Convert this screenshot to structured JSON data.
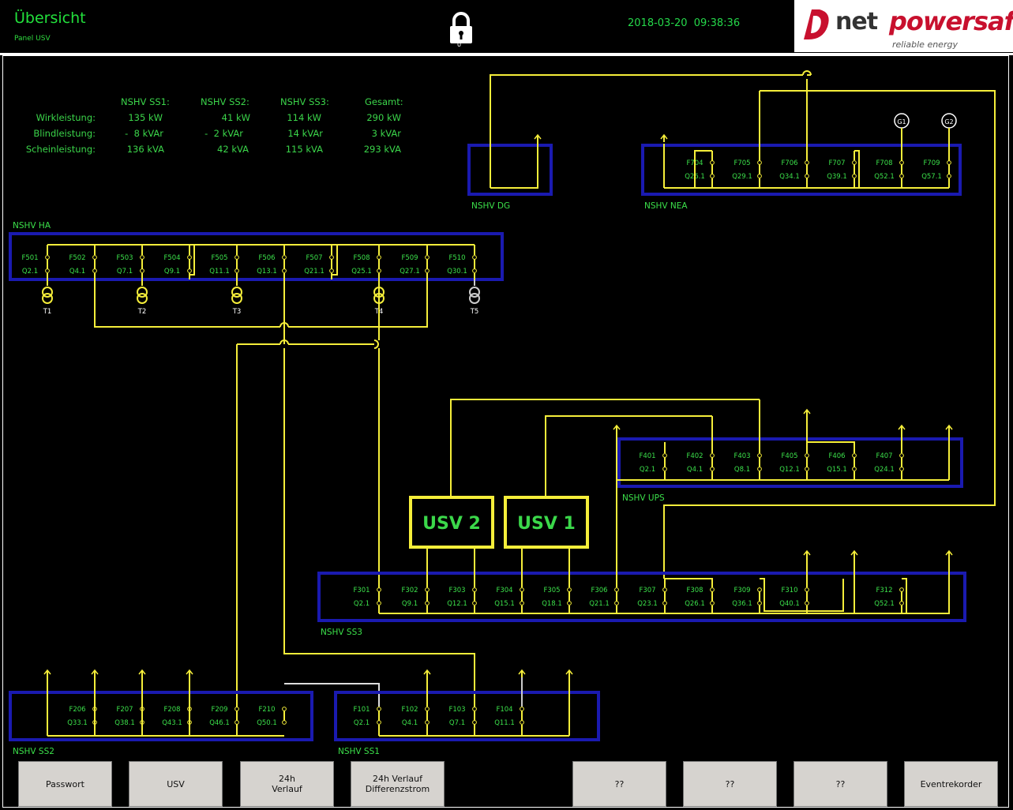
{
  "header": {
    "title": "Übersicht",
    "subtitle": "Panel USV",
    "lock_count": "0",
    "date": "2018-03-20",
    "time": "09:38:36"
  },
  "logo": {
    "word1": "net",
    "word2": "powersafe",
    "tagline": "reliable energy"
  },
  "stats": {
    "columns": [
      "NSHV SS1:",
      "NSHV SS2:",
      "NSHV SS3:",
      "Gesamt:"
    ],
    "rows": [
      {
        "label": "Wirkleistung:",
        "values": [
          "135 kW",
          "41 kW",
          "114 kW",
          "290 kW"
        ]
      },
      {
        "label": "Blindleistung:",
        "values": [
          "-  8 kVAr",
          "-  2 kVAr",
          "14 kVAr",
          "3 kVAr"
        ]
      },
      {
        "label": "Scheinleistung:",
        "values": [
          "136 kVA",
          "42 kVA",
          "115 kVA",
          "293 kVA"
        ]
      }
    ]
  },
  "panels": {
    "ha": "NSHV HA",
    "dg": "NSHV DG",
    "nea": "NSHV NEA",
    "ups": "NSHV UPS",
    "ss3": "NSHV SS3",
    "ss2": "NSHV SS2",
    "ss1": "NSHV SS1"
  },
  "usv": {
    "usv2": "USV 2",
    "usv1": "USV 1"
  },
  "transformers": [
    "T1",
    "T2",
    "T3",
    "T4",
    "T5"
  ],
  "generators": [
    "G1",
    "G2"
  ],
  "feeders": {
    "ha": [
      [
        "F501",
        "Q2.1"
      ],
      [
        "F502",
        "Q4.1"
      ],
      [
        "F503",
        "Q7.1"
      ],
      [
        "F504",
        "Q9.1"
      ],
      [
        "F505",
        "Q11.1"
      ],
      [
        "F506",
        "Q13.1"
      ],
      [
        "F507",
        "Q21.1"
      ],
      [
        "F508",
        "Q25.1"
      ],
      [
        "F509",
        "Q27.1"
      ],
      [
        "F510",
        "Q30.1"
      ]
    ],
    "nea": [
      [
        "F704",
        "Q26.1"
      ],
      [
        "F705",
        "Q29.1"
      ],
      [
        "F706",
        "Q34.1"
      ],
      [
        "F707",
        "Q39.1"
      ],
      [
        "F708",
        "Q52.1"
      ],
      [
        "F709",
        "Q57.1"
      ]
    ],
    "ups": [
      [
        "F401",
        "Q2.1"
      ],
      [
        "F402",
        "Q4.1"
      ],
      [
        "F403",
        "Q8.1"
      ],
      [
        "F405",
        "Q12.1"
      ],
      [
        "F406",
        "Q15.1"
      ],
      [
        "F407",
        "Q24.1"
      ]
    ],
    "ss3": [
      [
        "F301",
        "Q2.1"
      ],
      [
        "F302",
        "Q9.1"
      ],
      [
        "F303",
        "Q12.1"
      ],
      [
        "F304",
        "Q15.1"
      ],
      [
        "F305",
        "Q18.1"
      ],
      [
        "F306",
        "Q21.1"
      ],
      [
        "F307",
        "Q23.1"
      ],
      [
        "F308",
        "Q26.1"
      ],
      [
        "F309",
        "Q36.1"
      ],
      [
        "F310",
        "Q40.1"
      ],
      [
        "F312",
        "Q52.1"
      ]
    ],
    "ss2": [
      [
        "F206",
        "Q33.1"
      ],
      [
        "F207",
        "Q38.1"
      ],
      [
        "F208",
        "Q43.1"
      ],
      [
        "F209",
        "Q46.1"
      ],
      [
        "F210",
        "Q50.1"
      ]
    ],
    "ss1": [
      [
        "F101",
        "Q2.1"
      ],
      [
        "F102",
        "Q4.1"
      ],
      [
        "F103",
        "Q7.1"
      ],
      [
        "F104",
        "Q11.1"
      ]
    ]
  },
  "buttons": {
    "passwort": "Passwort",
    "usv": "USV",
    "verlauf_line1": "24h",
    "verlauf_line2": "Verlauf",
    "diff_line1": "24h Verlauf",
    "diff_line2": "Differenzstrom",
    "q1": "??",
    "q2": "??",
    "q3": "??",
    "eventrekorder": "Eventrekorder"
  },
  "colors": {
    "accent_green": "#22e03c",
    "line_yellow": "#f5ee3a",
    "panel_blue": "#1a1ab0",
    "button_gray": "#d6d3cf",
    "brand_red": "#c8102e"
  }
}
